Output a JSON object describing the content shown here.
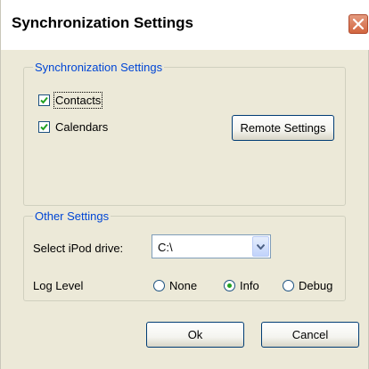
{
  "window": {
    "title": "Synchronization Settings"
  },
  "sync_group": {
    "legend": "Synchronization Settings",
    "contacts": {
      "label": "Contacts",
      "checked": true
    },
    "calendars": {
      "label": "Calendars",
      "checked": true
    },
    "remote_button": "Remote Settings"
  },
  "other_group": {
    "legend": "Other Settings",
    "ipod_label": "Select iPod drive:",
    "ipod_value": "C:\\",
    "log_label": "Log Level",
    "log_options": [
      {
        "label": "None",
        "checked": false
      },
      {
        "label": "Info",
        "checked": true
      },
      {
        "label": "Debug",
        "checked": false
      }
    ]
  },
  "buttons": {
    "ok": "Ok",
    "cancel": "Cancel"
  },
  "colors": {
    "accent_legend": "#0046d5",
    "close_red": "#d2653f"
  }
}
